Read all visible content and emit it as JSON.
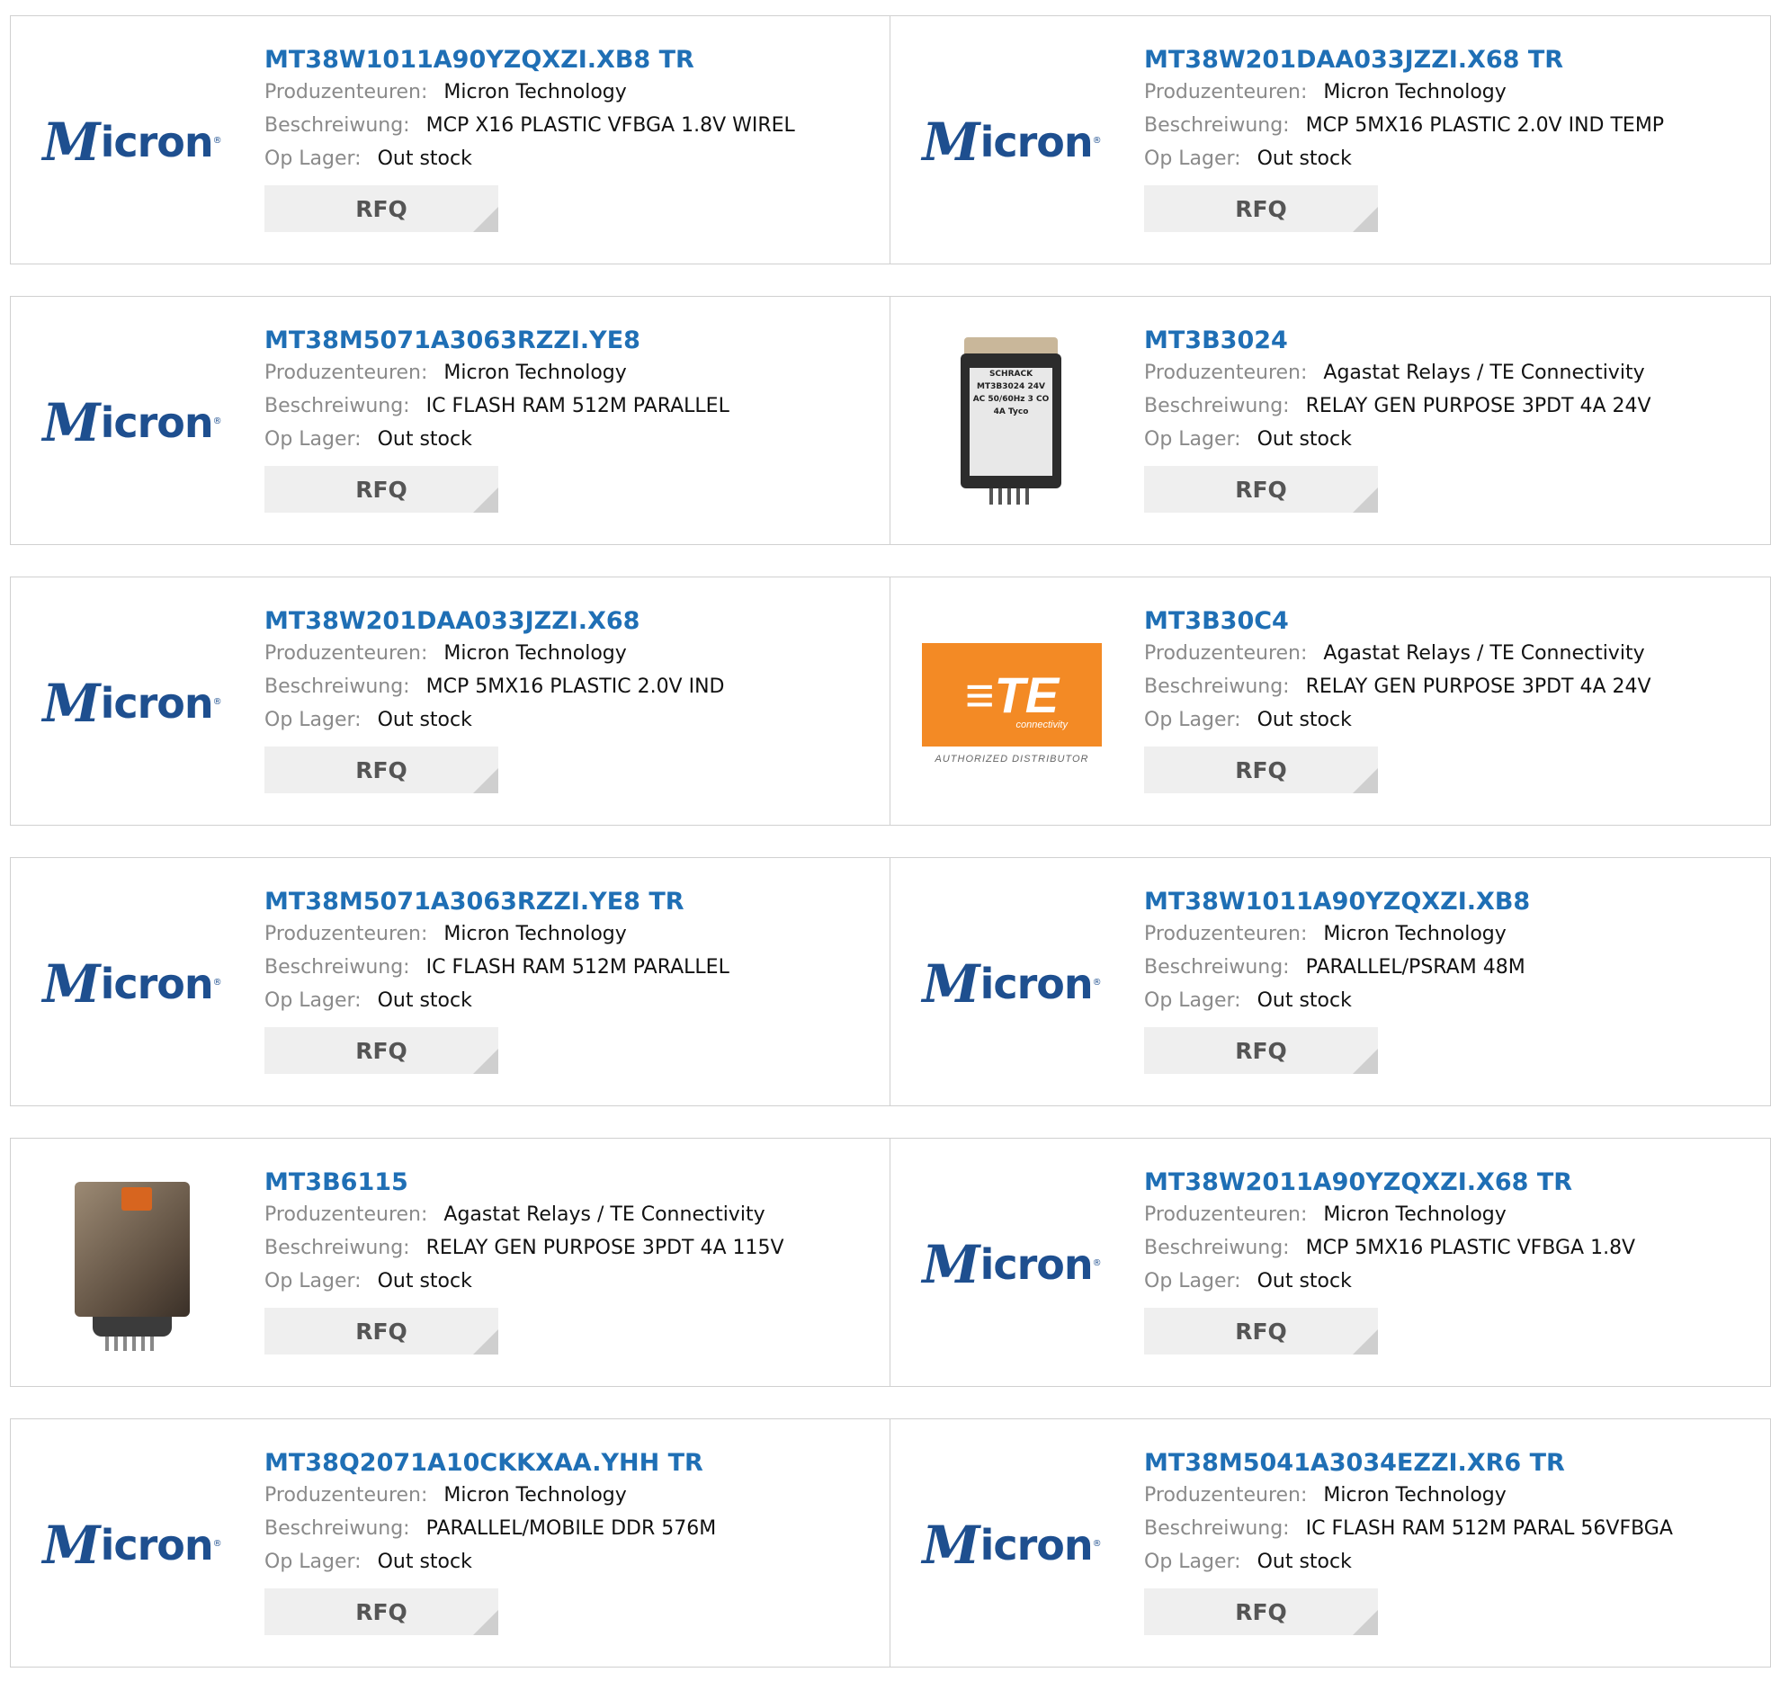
{
  "labels": {
    "manufacturer": "Produzenteuren:",
    "description": "Beschreiwung:",
    "stock": "Op Lager:",
    "rfq": "RFQ"
  },
  "logos": {
    "micron": {
      "m": "M",
      "rest": "icron",
      "reg": "®"
    },
    "te": {
      "mark": "≡TE",
      "sub": "connectivity",
      "dist": "AUTHORIZED DISTRIBUTOR"
    },
    "relay_label": "SCHRACK MT3B3024 24V AC 50/60Hz 3 CO 4A Tyco"
  },
  "products": [
    {
      "part": "MT38W1011A90YZQXZI.XB8 TR",
      "manufacturer": "Micron Technology",
      "description": "MCP X16 PLASTIC VFBGA 1.8V WIREL",
      "stock": "Out stock",
      "image": "micron-logo"
    },
    {
      "part": "MT38W201DAA033JZZI.X68 TR",
      "manufacturer": "Micron Technology",
      "description": "MCP 5MX16 PLASTIC 2.0V IND TEMP",
      "stock": "Out stock",
      "image": "micron-logo"
    },
    {
      "part": "MT38M5071A3063RZZI.YE8",
      "manufacturer": "Micron Technology",
      "description": "IC FLASH RAM 512M PARALLEL",
      "stock": "Out stock",
      "image": "micron-logo"
    },
    {
      "part": "MT3B3024",
      "manufacturer": "Agastat Relays / TE Connectivity",
      "description": "RELAY GEN PURPOSE 3PDT 4A 24V",
      "stock": "Out stock",
      "image": "relay-photo"
    },
    {
      "part": "MT38W201DAA033JZZI.X68",
      "manufacturer": "Micron Technology",
      "description": "MCP 5MX16 PLASTIC 2.0V IND",
      "stock": "Out stock",
      "image": "micron-logo"
    },
    {
      "part": "MT3B30C4",
      "manufacturer": "Agastat Relays / TE Connectivity",
      "description": "RELAY GEN PURPOSE 3PDT 4A 24V",
      "stock": "Out stock",
      "image": "te-logo"
    },
    {
      "part": "MT38M5071A3063RZZI.YE8 TR",
      "manufacturer": "Micron Technology",
      "description": "IC FLASH RAM 512M PARALLEL",
      "stock": "Out stock",
      "image": "micron-logo"
    },
    {
      "part": "MT38W1011A90YZQXZI.XB8",
      "manufacturer": "Micron Technology",
      "description": "PARALLEL/PSRAM 48M",
      "stock": "Out stock",
      "image": "micron-logo"
    },
    {
      "part": "MT3B6115",
      "manufacturer": "Agastat Relays / TE Connectivity",
      "description": "RELAY GEN PURPOSE 3PDT 4A 115V",
      "stock": "Out stock",
      "image": "relay-photo-2"
    },
    {
      "part": "MT38W2011A90YZQXZI.X68 TR",
      "manufacturer": "Micron Technology",
      "description": "MCP 5MX16 PLASTIC VFBGA 1.8V",
      "stock": "Out stock",
      "image": "micron-logo"
    },
    {
      "part": "MT38Q2071A10CKKXAA.YHH TR",
      "manufacturer": "Micron Technology",
      "description": "PARALLEL/MOBILE DDR 576M",
      "stock": "Out stock",
      "image": "micron-logo"
    },
    {
      "part": "MT38M5041A3034EZZI.XR6 TR",
      "manufacturer": "Micron Technology",
      "description": "IC FLASH RAM 512M PARAL 56VFBGA",
      "stock": "Out stock",
      "image": "micron-logo"
    }
  ]
}
